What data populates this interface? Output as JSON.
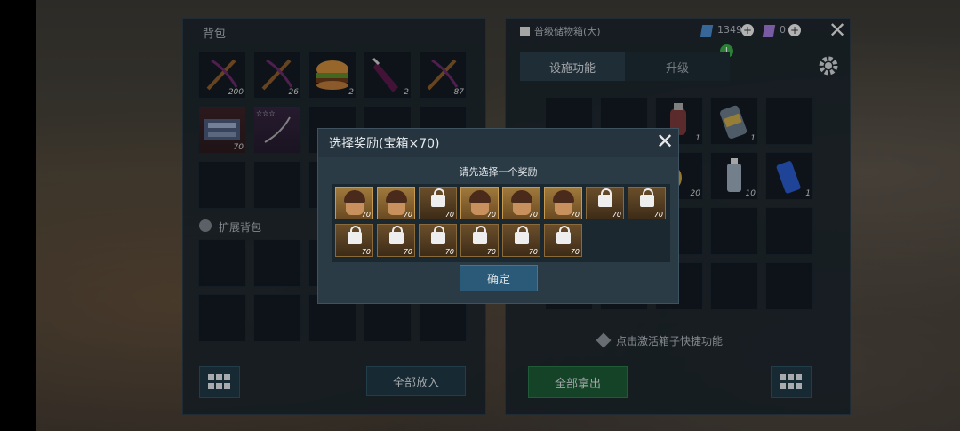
{
  "left_panel": {
    "title": "背包",
    "expand_label": "扩展背包",
    "put_all_label": "全部放入",
    "items": [
      {
        "name": "crossbow-item",
        "count": "200"
      },
      {
        "name": "crossbow-item",
        "count": "26"
      },
      {
        "name": "burger-item",
        "count": "2"
      },
      {
        "name": "bottle-item",
        "count": "2"
      },
      {
        "name": "crossbow-item",
        "count": "87"
      },
      {
        "name": "chest-item",
        "count": "70"
      },
      {
        "name": "bow-item",
        "count": ""
      }
    ]
  },
  "right_panel": {
    "title": "普级储物箱(大)",
    "currency1": "1349",
    "currency2": "0",
    "tab_active": "设施功能",
    "tab_upgrade": "升级",
    "take_all_label": "全部拿出",
    "hint": "点击激活箱子快捷功能",
    "items": [
      {
        "name": "grenade-item",
        "count": "1"
      },
      {
        "name": "canister-item",
        "count": "1"
      },
      {
        "name": "rope-item",
        "count": "20"
      },
      {
        "name": "spray-can-item",
        "count": "10"
      },
      {
        "name": "blue-can-item",
        "count": "1"
      }
    ]
  },
  "modal": {
    "title": "选择奖励(宝箱×70)",
    "subtitle": "请先选择一个奖励",
    "confirm_label": "确定",
    "rewards": [
      {
        "locked": false,
        "level": "70"
      },
      {
        "locked": false,
        "level": "70"
      },
      {
        "locked": true,
        "level": "70"
      },
      {
        "locked": false,
        "level": "70"
      },
      {
        "locked": false,
        "level": "70"
      },
      {
        "locked": false,
        "level": "70"
      },
      {
        "locked": true,
        "level": "70"
      },
      {
        "locked": true,
        "level": "70"
      },
      {
        "locked": true,
        "level": "70"
      },
      {
        "locked": true,
        "level": "70"
      },
      {
        "locked": true,
        "level": "70"
      },
      {
        "locked": true,
        "level": "70"
      },
      {
        "locked": true,
        "level": "70"
      },
      {
        "locked": true,
        "level": "70"
      }
    ]
  },
  "colors": {
    "panel": "#1b252c",
    "accent_green": "#1d5a36",
    "gold": "#a07a3c"
  }
}
